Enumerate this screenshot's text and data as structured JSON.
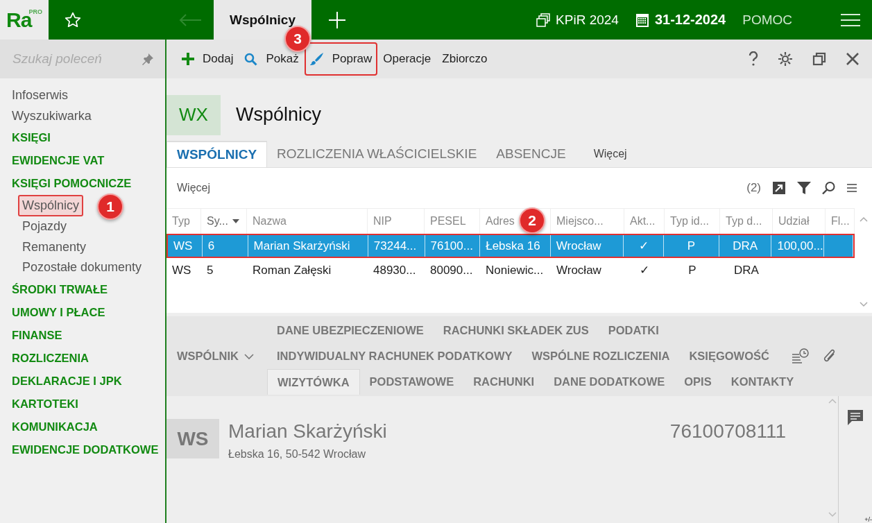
{
  "app": {
    "logo": "Ra",
    "logo_badge": "PRO"
  },
  "top_bar": {
    "tab": "Wspólnicy",
    "book": "KPiR 2024",
    "date": "31-12-2024",
    "help": "POMOC"
  },
  "sidebar": {
    "search_placeholder": "Szukaj poleceń",
    "items": [
      {
        "label": "Infoserwis",
        "kind": "link",
        "highlighted": false
      },
      {
        "label": "Wyszukiwarka",
        "kind": "link",
        "highlighted": false
      },
      {
        "label": "KSIĘGI",
        "kind": "section",
        "highlighted": false
      },
      {
        "label": "EWIDENCJE VAT",
        "kind": "section",
        "highlighted": false
      },
      {
        "label": "KSIĘGI POMOCNICZE",
        "kind": "section",
        "highlighted": false
      },
      {
        "label": "Wspólnicy",
        "kind": "sub",
        "highlighted": true
      },
      {
        "label": "Pojazdy",
        "kind": "sub",
        "highlighted": false
      },
      {
        "label": "Remanenty",
        "kind": "sub",
        "highlighted": false
      },
      {
        "label": "Pozostałe dokumenty",
        "kind": "sub",
        "highlighted": false
      },
      {
        "label": "ŚRODKI TRWAŁE",
        "kind": "section",
        "highlighted": false
      },
      {
        "label": "UMOWY I PŁACE",
        "kind": "section",
        "highlighted": false
      },
      {
        "label": "FINANSE",
        "kind": "section",
        "highlighted": false
      },
      {
        "label": "ROZLICZENIA",
        "kind": "section",
        "highlighted": false
      },
      {
        "label": "DEKLARACJE I JPK",
        "kind": "section",
        "highlighted": false
      },
      {
        "label": "KARTOTEKI",
        "kind": "section",
        "highlighted": false
      },
      {
        "label": "KOMUNIKACJA",
        "kind": "section",
        "highlighted": false
      },
      {
        "label": "EWIDENCJE DODATKOWE",
        "kind": "section",
        "highlighted": false
      }
    ]
  },
  "toolbar": {
    "items": [
      {
        "label": "Dodaj",
        "kind": "add",
        "highlighted": false
      },
      {
        "label": "Pokaż",
        "kind": "show",
        "highlighted": false
      },
      {
        "label": "Popraw",
        "kind": "edit",
        "highlighted": true
      },
      {
        "label": "Operacje",
        "kind": "plain",
        "highlighted": false
      },
      {
        "label": "Zbiorczo",
        "kind": "plain",
        "highlighted": false
      }
    ]
  },
  "module": {
    "code": "WX",
    "title": "Wspólnicy"
  },
  "tabs": [
    {
      "label": "WSPÓLNICY",
      "selected": true
    },
    {
      "label": "ROZLICZENIA WŁAŚCICIELSKIE",
      "selected": false
    },
    {
      "label": "ABSENCJE",
      "selected": false
    }
  ],
  "tabs_more": "Więcej",
  "list": {
    "more": "Więcej",
    "count": "(2)",
    "columns": [
      {
        "label": "Typ",
        "sorted": false
      },
      {
        "label": "Sy...",
        "sorted": true
      },
      {
        "label": "Nazwa",
        "sorted": false
      },
      {
        "label": "NIP",
        "sorted": false
      },
      {
        "label": "PESEL",
        "sorted": false
      },
      {
        "label": "Adres",
        "sorted": false
      },
      {
        "label": "Miejsco...",
        "sorted": false
      },
      {
        "label": "Akt...",
        "sorted": false
      },
      {
        "label": "Typ id...",
        "sorted": false
      },
      {
        "label": "Typ d...",
        "sorted": false
      },
      {
        "label": "Udział",
        "sorted": false
      },
      {
        "label": "Fl...",
        "sorted": false
      }
    ],
    "rows": [
      {
        "selected": true,
        "highlighted": true,
        "cells": [
          "WS",
          "6",
          "Marian Skarżyński",
          "73244...",
          "76100...",
          "Łebska 16",
          "Wrocław",
          "✓",
          "P",
          "DRA",
          "100,00...",
          ""
        ]
      },
      {
        "selected": false,
        "highlighted": false,
        "cells": [
          "WS",
          "5",
          "Roman Załęski",
          "48930...",
          "80090...",
          "Noniewic...",
          "Wrocław",
          "✓",
          "P",
          "DRA",
          "",
          ""
        ]
      }
    ]
  },
  "detail_menu": {
    "label": "WSPÓLNIK",
    "tab_rows": [
      [
        {
          "label": "DANE UBEZPIECZENIOWE",
          "selected": false
        },
        {
          "label": "RACHUNKI SKŁADEK ZUS",
          "selected": false
        },
        {
          "label": "PODATKI",
          "selected": false
        }
      ],
      [
        {
          "label": "INDYWIDUALNY RACHUNEK PODATKOWY",
          "selected": false
        },
        {
          "label": "WSPÓLNE ROZLICZENIA",
          "selected": false
        },
        {
          "label": "KSIĘGOWOŚĆ",
          "selected": false
        }
      ],
      [
        {
          "label": "WIZYTÓWKA",
          "selected": true
        },
        {
          "label": "PODSTAWOWE",
          "selected": false
        },
        {
          "label": "RACHUNKI",
          "selected": false
        },
        {
          "label": "DANE DODATKOWE",
          "selected": false
        },
        {
          "label": "OPIS",
          "selected": false
        },
        {
          "label": "KONTAKTY",
          "selected": false
        }
      ]
    ]
  },
  "card": {
    "badge": "WS",
    "name": "Marian Skarżyński",
    "address": "Łebska 16, 50-542 Wrocław",
    "number": "76100708111"
  },
  "corner_mark": "+/-",
  "callouts": [
    {
      "number": "1"
    },
    {
      "number": "2"
    },
    {
      "number": "3"
    }
  ]
}
